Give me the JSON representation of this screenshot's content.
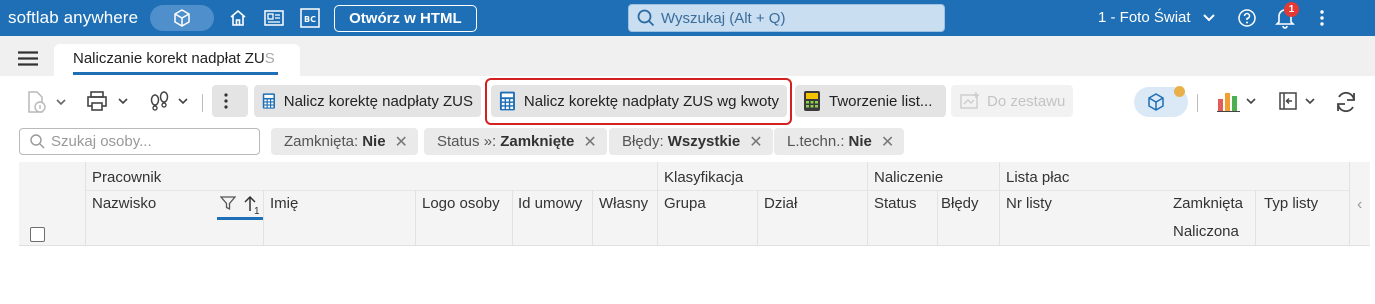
{
  "topbar": {
    "brand": "softlab anywhere",
    "open_html_label": "Otwórz w HTML",
    "search_placeholder": "Wyszukaj (Alt + Q)",
    "company": "1 - Foto Świat",
    "notification_count": "1",
    "icons": [
      "cube-icon",
      "home-icon",
      "news-icon",
      "bc-icon",
      "help-icon",
      "bell-icon",
      "more-icon"
    ],
    "bc_label": "BC",
    "background": "#1e6fb5"
  },
  "tabs": {
    "active": "Naliczanie korekt nadpłat ZUS",
    "active_visible": "Naliczanie korekt nadpłat ZU",
    "active_fade": "S"
  },
  "toolbar": {
    "btn_nalicz": "Nalicz korektę nadpłaty ZUS",
    "btn_nalicz_kwoty": "Nalicz korektę nadpłaty ZUS wg kwoty",
    "btn_tworzenie": "Tworzenie list...",
    "btn_do_zestawu": "Do zestawu",
    "highlight_color": "#d32020"
  },
  "filters": {
    "person_search_placeholder": "Szukaj osoby...",
    "chips": [
      {
        "label": "Zamknięta:",
        "value": "Nie"
      },
      {
        "label": "Status »:",
        "value": "Zamknięte"
      },
      {
        "label": "Błędy:",
        "value": "Wszystkie"
      },
      {
        "label": "L.techn.:",
        "value": "Nie"
      }
    ]
  },
  "grid": {
    "groups": [
      "Pracownik",
      "Klasyfikacja",
      "Naliczenie",
      "Lista płac"
    ],
    "columns": [
      "Nazwisko",
      "Imię",
      "Logo osoby",
      "Id umowy",
      "Własny",
      "Grupa",
      "Dział",
      "Status",
      "Błędy",
      "Nr listy",
      "Zamknięta",
      "Typ listy"
    ],
    "sub_column": "Naliczona",
    "sort_index": "1",
    "collapse_glyph": "‹"
  }
}
